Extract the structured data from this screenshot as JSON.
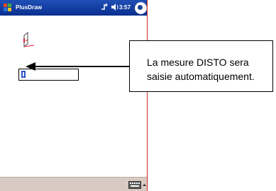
{
  "titlebar": {
    "app_title": "PlusDraw",
    "time": "3:57"
  },
  "icons": {
    "start": "windows-start-flag-icon",
    "signal": "connectivity-icon",
    "volume": "speaker-icon",
    "ok": "ok-close-icon",
    "disto": "disto-measure-icon",
    "keyboard": "keyboard-input-icon",
    "input_arrow": "chevron-up-icon"
  },
  "colors": {
    "titlebar": "#1f4fb6",
    "taskbar": "#d9cac3",
    "screen_border": "#cc2a2a"
  },
  "callout": {
    "text": "La mesure DISTO sera saisie automatiquement."
  }
}
